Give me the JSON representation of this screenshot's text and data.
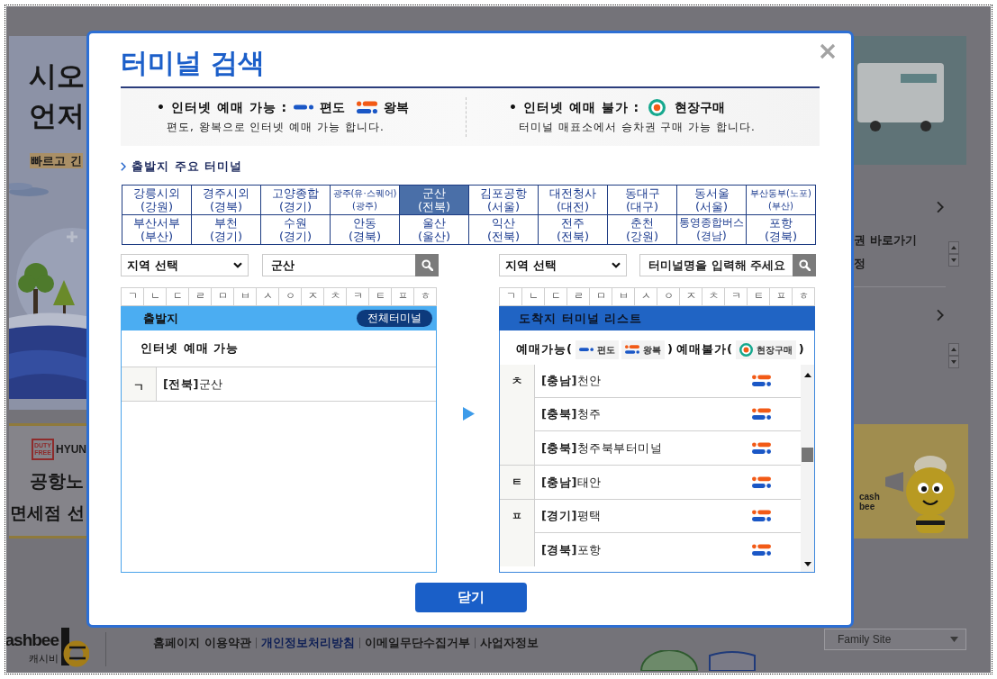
{
  "background_page": {
    "promo_banner": {
      "headline": [
        "시오",
        "언저"
      ],
      "tagline": "빠르고 긴"
    },
    "duty_free_ad": {
      "badge": "DUTY FREE",
      "brand": "HYUN",
      "lines": [
        "공항노",
        "면세점 선"
      ]
    },
    "side_menu": {
      "items": [
        "권 바로가기",
        "정"
      ]
    },
    "cashbee_ad": {
      "logo_lines": [
        "cash",
        "bee"
      ]
    },
    "footer": {
      "logo": "ashbee",
      "logo_caption": "캐시비",
      "links": [
        {
          "label": "홈페이지 이용약관",
          "emphasized": false
        },
        {
          "label": "개인정보처리방침",
          "emphasized": true
        },
        {
          "label": "이메일무단수집거부",
          "emphasized": false
        },
        {
          "label": "사업자정보",
          "emphasized": false
        }
      ],
      "family_site": "Family Site"
    }
  },
  "dialog": {
    "title": "터미널 검색",
    "legend": {
      "available": {
        "label": "• 인터넷 예매 가능 :",
        "one_way": "편도",
        "round_trip": "왕복",
        "note": "편도, 왕복으로 인터넷 예매 가능 합니다."
      },
      "unavailable": {
        "label": "• 인터넷 예매 불가 :",
        "on_site": "현장구매",
        "note": "터미널 매표소에서 승차권 구매 가능 합니다."
      }
    },
    "major_terminals": {
      "heading": "출발지 주요 터미널",
      "items": [
        {
          "name": "강릉시외",
          "region": "(강원)",
          "selected": false
        },
        {
          "name": "경주시외",
          "region": "(경북)",
          "selected": false
        },
        {
          "name": "고양종합",
          "region": "(경기)",
          "selected": false
        },
        {
          "name": "광주(유·스퀘어)",
          "region": "(광주)",
          "selected": false
        },
        {
          "name": "군산",
          "region": "(전북)",
          "selected": true
        },
        {
          "name": "김포공항",
          "region": "(서울)",
          "selected": false
        },
        {
          "name": "대전청사",
          "region": "(대전)",
          "selected": false
        },
        {
          "name": "동대구",
          "region": "(대구)",
          "selected": false
        },
        {
          "name": "동서울",
          "region": "(서울)",
          "selected": false
        },
        {
          "name": "부산동부(노포)",
          "region": "(부산)",
          "selected": false
        },
        {
          "name": "부산서부",
          "region": "(부산)",
          "selected": false
        },
        {
          "name": "부천",
          "region": "(경기)",
          "selected": false
        },
        {
          "name": "수원",
          "region": "(경기)",
          "selected": false
        },
        {
          "name": "안동",
          "region": "(경북)",
          "selected": false
        },
        {
          "name": "울산",
          "region": "(울산)",
          "selected": false
        },
        {
          "name": "익산",
          "region": "(전북)",
          "selected": false
        },
        {
          "name": "전주",
          "region": "(전북)",
          "selected": false
        },
        {
          "name": "춘천",
          "region": "(강원)",
          "selected": false
        },
        {
          "name": "통영종합버스",
          "region": "(경남)",
          "selected": false
        },
        {
          "name": "포항",
          "region": "(경북)",
          "selected": false
        }
      ]
    },
    "departure": {
      "region_select": "지역 선택",
      "search": {
        "value": "군산"
      },
      "consonants": [
        "ㄱ",
        "ㄴ",
        "ㄷ",
        "ㄹ",
        "ㅁ",
        "ㅂ",
        "ㅅ",
        "ㅇ",
        "ㅈ",
        "ㅊ",
        "ㅋ",
        "ㅌ",
        "ㅍ",
        "ㅎ"
      ],
      "header": "출발지",
      "all_terminals_button": "전체터미널",
      "section": "인터넷 예매 가능",
      "groups": [
        {
          "initial": "ㄱ",
          "terminals": [
            {
              "name": "**[전북]**군산"
            }
          ]
        }
      ]
    },
    "arrival": {
      "region_select": "지역 선택",
      "search": {
        "placeholder": "터미널명을 입력해 주세요"
      },
      "consonants": [
        "ㄱ",
        "ㄴ",
        "ㄷ",
        "ㄹ",
        "ㅁ",
        "ㅂ",
        "ㅅ",
        "ㅇ",
        "ㅈ",
        "ㅊ",
        "ㅋ",
        "ㅌ",
        "ㅍ",
        "ㅎ"
      ],
      "header": "도착지 터미널 리스트",
      "legend": [
        {
          "kind": "text",
          "text": "예매가능("
        },
        {
          "kind": "one_way",
          "label": "편도"
        },
        {
          "kind": "round_trip",
          "label": "왕복"
        },
        {
          "kind": "text",
          "text": ")"
        },
        {
          "kind": "text",
          "text": "예매불가("
        },
        {
          "kind": "on_site",
          "label": "현장구매"
        },
        {
          "kind": "text",
          "text": ")"
        }
      ],
      "groups": [
        {
          "initial": "ㅊ",
          "terminals": [
            {
              "name": "**[충남]**천안",
              "kind": "round_trip"
            },
            {
              "name": "**[충북]**청주",
              "kind": "round_trip"
            },
            {
              "name": "**[충북]**청주북부터미널",
              "kind": "round_trip"
            }
          ]
        },
        {
          "initial": "ㅌ",
          "terminals": [
            {
              "name": "**[충남]**태안",
              "kind": "round_trip"
            }
          ]
        },
        {
          "initial": "ㅍ",
          "terminals": [
            {
              "name": "**[경기]**평택",
              "kind": "round_trip"
            },
            {
              "name": "**[경북]**포항",
              "kind": "round_trip"
            }
          ]
        }
      ]
    },
    "close_button": "닫기"
  }
}
